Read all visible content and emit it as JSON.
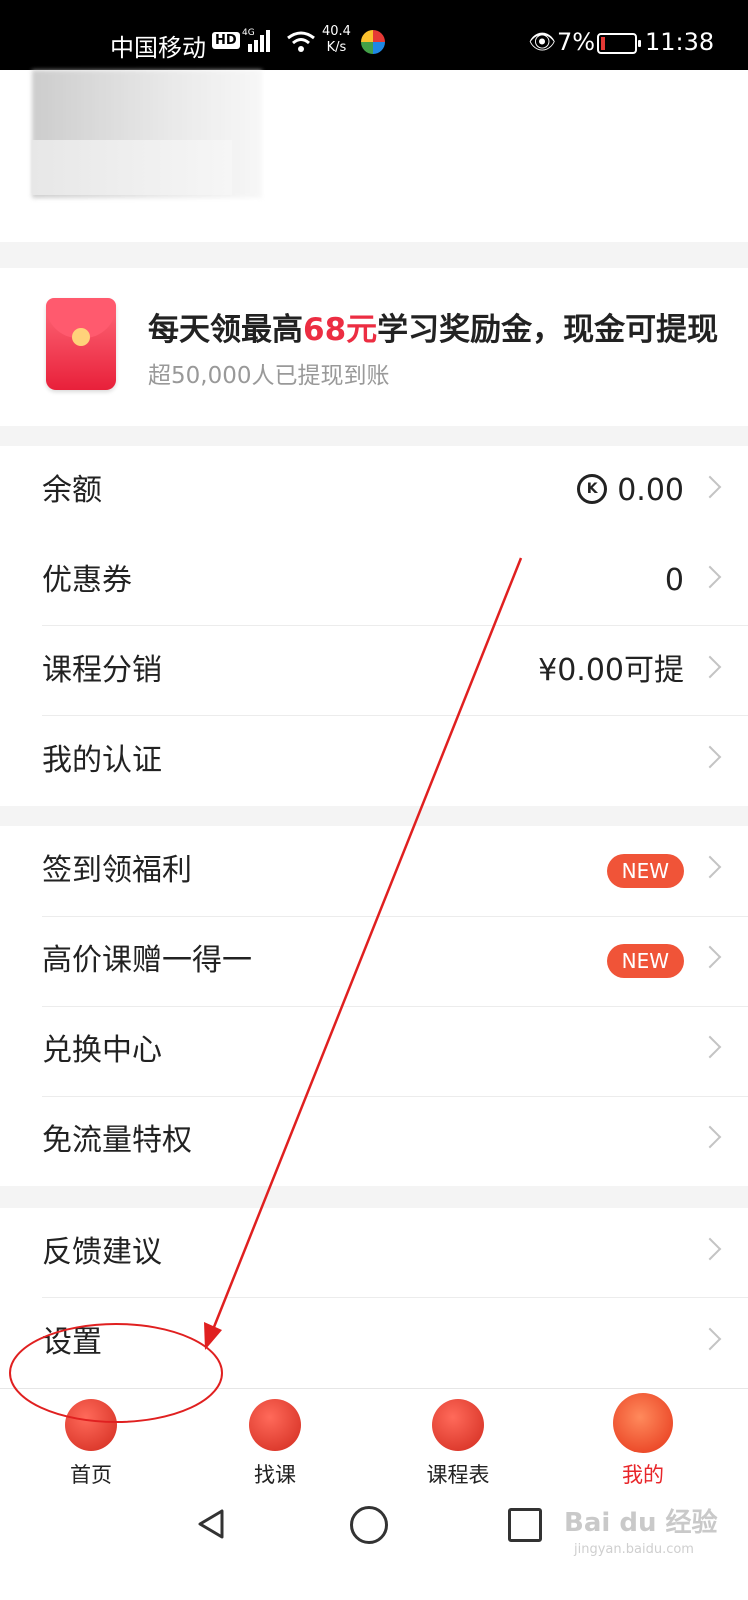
{
  "status_bar": {
    "carrier": "中国移动",
    "hd": "HD",
    "network": "4G",
    "speed_value": "40.4",
    "speed_unit": "K/s",
    "battery": "7%",
    "time": "11:38"
  },
  "promo": {
    "title_prefix": "每天领最高",
    "title_highlight": "68元",
    "title_suffix": "学习奖励金，现金可提现",
    "subtitle": "超50,000人已提现到账"
  },
  "wallet": [
    {
      "label": "余额",
      "value": "0.00",
      "coin_glyph": "K"
    },
    {
      "label": "优惠券",
      "value": "0"
    },
    {
      "label": "课程分销",
      "value": "¥0.00可提"
    },
    {
      "label": "我的认证",
      "value": ""
    }
  ],
  "benefits": [
    {
      "label": "签到领福利",
      "badge": "NEW"
    },
    {
      "label": "高价课赠一得一",
      "badge": "NEW"
    },
    {
      "label": "兑换中心",
      "badge": ""
    },
    {
      "label": "免流量特权",
      "badge": ""
    }
  ],
  "support": [
    {
      "label": "反馈建议"
    },
    {
      "label": "设置"
    }
  ],
  "tabs": [
    {
      "label": "首页",
      "icon": "home-gate-icon"
    },
    {
      "label": "找课",
      "icon": "cursor-icon"
    },
    {
      "label": "课程表",
      "icon": "lantern-icon"
    },
    {
      "label": "我的",
      "icon": "ox-mascot-icon",
      "active": true
    }
  ],
  "watermark": {
    "text": "Bai du 经验",
    "url": "jingyan.baidu.com"
  },
  "colors": {
    "accent": "#ec2d42",
    "badge": "#f05438",
    "annotation": "#e02020"
  }
}
